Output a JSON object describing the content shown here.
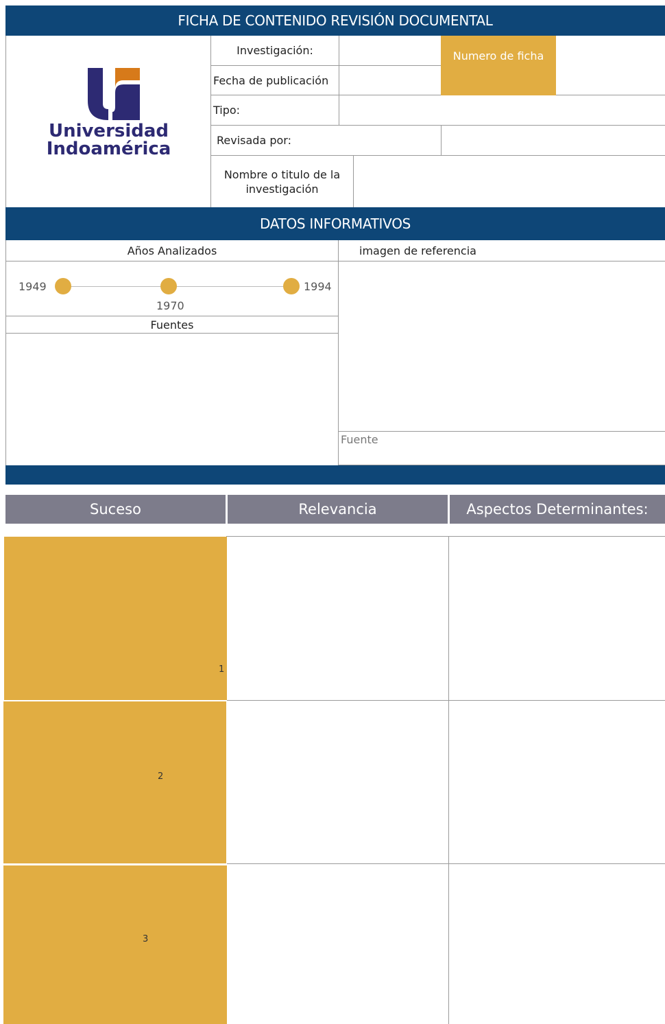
{
  "header": {
    "title": "FICHA DE CONTENIDO REVISIÓN DOCUMENTAL"
  },
  "logo": {
    "line1": "Universidad",
    "line2": "Indoamérica"
  },
  "fields": {
    "investigacion": "Investigación:",
    "fecha": "Fecha de publicación",
    "tipo": "Tipo:",
    "revisada": "Revisada por:",
    "nombre": "Nombre o titulo de la investigación",
    "numero_ficha": "Numero de ficha"
  },
  "datos": {
    "title": "DATOS INFORMATIVOS",
    "anios_label": "Años Analizados",
    "imagen_label": "imagen de referencia",
    "fuentes_label": "Fuentes",
    "fuente_label": "Fuente"
  },
  "timeline": {
    "years": [
      "1949",
      "1970",
      "1994"
    ]
  },
  "table": {
    "headers": [
      "Suceso",
      "Relevancia",
      "Aspectos Determinantes:"
    ],
    "rows": [
      "1",
      "2",
      "3"
    ]
  },
  "colors": {
    "navy": "#0e4677",
    "gold": "#e1ad42",
    "grey_header": "#7d7c8b",
    "logo_blue": "#2d2a73",
    "logo_orange": "#d77a1a"
  }
}
